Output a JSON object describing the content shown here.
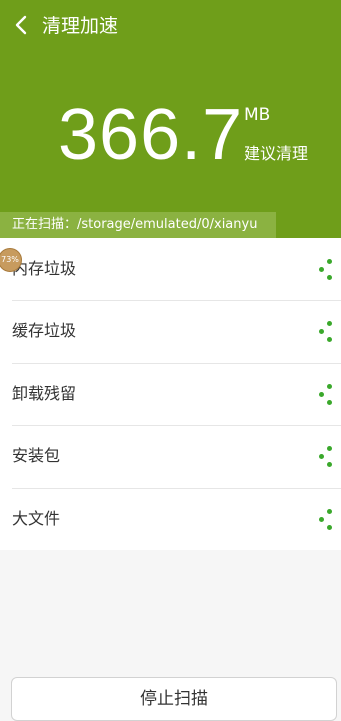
{
  "header": {
    "title": "清理加速",
    "size_value": "366.7",
    "size_unit": "MB",
    "suggest_label": "建议清理",
    "bg_color": "#6f9e1a"
  },
  "scan": {
    "status_text": "正在扫描：/storage/emulated/0/xianyu",
    "progress": 0.81,
    "badge_text": "73%"
  },
  "categories": [
    {
      "label": "内存垃圾"
    },
    {
      "label": "缓存垃圾"
    },
    {
      "label": "卸载残留"
    },
    {
      "label": "安装包"
    },
    {
      "label": "大文件"
    }
  ],
  "footer": {
    "stop_label": "停止扫描"
  },
  "icons": {
    "back": "chevron-left-icon",
    "loading": "loading-dots-icon"
  },
  "accent_color": "#3aa82b"
}
